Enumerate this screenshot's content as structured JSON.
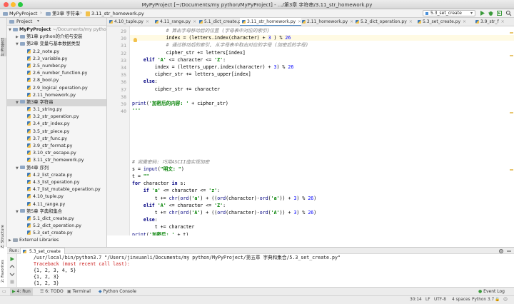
{
  "window": {
    "title": "MyPyProject [~/Documents/my python/MyPyProject] - .../第3章 字符串/3.11_str_homework.py"
  },
  "navbar": {
    "crumbs": [
      "MyPyProject",
      "第3章 字符串",
      "3.11_str_homework.py"
    ],
    "run_config": "5.3_set_create"
  },
  "left_stripe": {
    "project": "1: Project",
    "structure": "Z: Structure",
    "favorites": "2: Favorites"
  },
  "project_panel": {
    "header": "Project",
    "root": {
      "name": "MyPyProject",
      "path": "~/Documents/my pytho"
    },
    "tree": [
      {
        "label": "第1章 python的介绍与安装",
        "type": "folder",
        "depth": 1,
        "open": false
      },
      {
        "label": "第2章 变量与基本数据类型",
        "type": "folder",
        "depth": 1,
        "open": true
      },
      {
        "label": "2.2_note.py",
        "type": "file",
        "depth": 2
      },
      {
        "label": "2.3_variable.py",
        "type": "file",
        "depth": 2
      },
      {
        "label": "2.5_number.py",
        "type": "file",
        "depth": 2
      },
      {
        "label": "2.6_number_function.py",
        "type": "file",
        "depth": 2
      },
      {
        "label": "2.8_bool.py",
        "type": "file",
        "depth": 2
      },
      {
        "label": "2.9_logical_operation.py",
        "type": "file",
        "depth": 2
      },
      {
        "label": "2.11_homework.py",
        "type": "file",
        "depth": 2
      },
      {
        "label": "第3章 字符串",
        "type": "folder",
        "depth": 1,
        "open": true,
        "selected": true
      },
      {
        "label": "3.1_string.py",
        "type": "file",
        "depth": 2
      },
      {
        "label": "3.2_str_operation.py",
        "type": "file",
        "depth": 2
      },
      {
        "label": "3.4_str_index.py",
        "type": "file",
        "depth": 2
      },
      {
        "label": "3.5_str_piece.py",
        "type": "file",
        "depth": 2
      },
      {
        "label": "3.7_str_func.py",
        "type": "file",
        "depth": 2
      },
      {
        "label": "3.9_str_format.py",
        "type": "file",
        "depth": 2
      },
      {
        "label": "3.10_str_escape.py",
        "type": "file",
        "depth": 2
      },
      {
        "label": "3.11_str_homework.py",
        "type": "file",
        "depth": 2
      },
      {
        "label": "第4章 序列",
        "type": "folder",
        "depth": 1,
        "open": true
      },
      {
        "label": "4.2_list_create.py",
        "type": "file",
        "depth": 2
      },
      {
        "label": "4.3_list_operation.py",
        "type": "file",
        "depth": 2
      },
      {
        "label": "4.7_list_mutable_operation.py",
        "type": "file",
        "depth": 2
      },
      {
        "label": "4.10_tuple.py",
        "type": "file",
        "depth": 2
      },
      {
        "label": "4.11_range.py",
        "type": "file",
        "depth": 2
      },
      {
        "label": "第5章 字典和集合",
        "type": "folder",
        "depth": 1,
        "open": true
      },
      {
        "label": "5.1_dict_create.py",
        "type": "file",
        "depth": 2
      },
      {
        "label": "5.2_dict_operation.py",
        "type": "file",
        "depth": 2
      },
      {
        "label": "5.3_set_create.py",
        "type": "file",
        "depth": 2
      },
      {
        "label": "External Libraries",
        "type": "lib",
        "depth": 0,
        "open": false
      }
    ]
  },
  "tabs": [
    {
      "label": "4.10_tuple.py",
      "active": false
    },
    {
      "label": "4.11_range.py",
      "active": false
    },
    {
      "label": "5.1_dict_create.py",
      "active": false
    },
    {
      "label": "3.11_str_homework.py",
      "active": true
    },
    {
      "label": "2.11_homework.py",
      "active": false
    },
    {
      "label": "5.2_dict_operation.py",
      "active": false
    },
    {
      "label": "5.3_set_create.py",
      "active": false
    },
    {
      "label": "3.9_str_f",
      "active": false
    }
  ],
  "editor": {
    "line_numbers": [
      "29",
      "30",
      "31",
      "32",
      "33",
      "34",
      "35",
      "36",
      "37",
      "38",
      "39",
      "40"
    ],
    "code_lines": [
      {
        "ind": 3,
        "tokens": [
          [
            "cmt",
            "# 算出字母移动后的位置 (字母表中对应的索引)"
          ]
        ]
      },
      {
        "ind": 3,
        "hl": true,
        "tokens": [
          [
            "",
            "index = (letters.index(character) + "
          ],
          [
            "num",
            "3"
          ],
          [
            "",
            " ) % "
          ],
          [
            "num",
            "26"
          ]
        ]
      },
      {
        "ind": 3,
        "tokens": [
          [
            "cmt",
            "# 通过移动后的索引, 从字母表中取出对应的字母 (加密后的字母)"
          ]
        ]
      },
      {
        "ind": 3,
        "tokens": [
          [
            "",
            "cipher_str += letters[index]"
          ]
        ]
      },
      {
        "ind": 1,
        "tokens": [
          [
            "kw",
            "elif "
          ],
          [
            "str",
            "'A'"
          ],
          [
            "",
            " <= character <= "
          ],
          [
            "str",
            "'Z'"
          ],
          [
            "",
            ":"
          ]
        ]
      },
      {
        "ind": 2,
        "tokens": [
          [
            "",
            "index = (letters_upper.index(character) + "
          ],
          [
            "num",
            "3"
          ],
          [
            "",
            ") % "
          ],
          [
            "num",
            "26"
          ]
        ]
      },
      {
        "ind": 2,
        "tokens": [
          [
            "",
            "cipher_str += letters_upper[index]"
          ]
        ]
      },
      {
        "ind": 1,
        "tokens": [
          [
            "kw",
            "else"
          ],
          [
            "",
            ":"
          ]
        ]
      },
      {
        "ind": 2,
        "tokens": [
          [
            "",
            "cipher_str += character"
          ]
        ]
      },
      {
        "ind": 0,
        "tokens": []
      },
      {
        "ind": 0,
        "tokens": [
          [
            "bi",
            "print"
          ],
          [
            "",
            "("
          ],
          [
            "str",
            "'加密后的内容: '"
          ],
          [
            "",
            " + cipher_str)"
          ]
        ]
      },
      {
        "ind": 0,
        "tokens": [
          [
            "str",
            "'''"
          ]
        ]
      },
      {
        "ind": 0,
        "tokens": []
      },
      {
        "ind": 0,
        "tokens": []
      },
      {
        "ind": 0,
        "tokens": []
      },
      {
        "ind": 0,
        "tokens": []
      },
      {
        "ind": 0,
        "tokens": []
      },
      {
        "ind": 0,
        "tokens": []
      },
      {
        "ind": 0,
        "tokens": [
          [
            "cmt",
            "# 凯撒密码: 巧用ASCII值实现加密"
          ]
        ]
      },
      {
        "ind": 0,
        "tokens": [
          [
            "",
            "s = "
          ],
          [
            "bi",
            "input"
          ],
          [
            "",
            "("
          ],
          [
            "str",
            "\"明文: \""
          ],
          [
            "",
            ")"
          ]
        ]
      },
      {
        "ind": 0,
        "tokens": [
          [
            "",
            "t = "
          ],
          [
            "str",
            "\"\""
          ]
        ]
      },
      {
        "ind": 0,
        "tokens": [
          [
            "kw",
            "for "
          ],
          [
            "",
            "character "
          ],
          [
            "kw",
            "in "
          ],
          [
            "",
            "s:"
          ]
        ]
      },
      {
        "ind": 1,
        "tokens": [
          [
            "kw",
            "if "
          ],
          [
            "str",
            "'a'"
          ],
          [
            "",
            " <= character <= "
          ],
          [
            "str",
            "'z'"
          ],
          [
            "",
            ":"
          ]
        ]
      },
      {
        "ind": 2,
        "tokens": [
          [
            "",
            "t += "
          ],
          [
            "bi",
            "chr"
          ],
          [
            "",
            "("
          ],
          [
            "bi",
            "ord"
          ],
          [
            "",
            "("
          ],
          [
            "str",
            "'a'"
          ],
          [
            "",
            ") + (("
          ],
          [
            "bi",
            "ord"
          ],
          [
            "",
            "(character)-"
          ],
          [
            "bi",
            "ord"
          ],
          [
            "",
            "("
          ],
          [
            "str",
            "'a'"
          ],
          [
            "",
            ")) + "
          ],
          [
            "num",
            "3"
          ],
          [
            "",
            ") % "
          ],
          [
            "num",
            "26"
          ],
          [
            "",
            ")"
          ]
        ]
      },
      {
        "ind": 1,
        "tokens": [
          [
            "kw",
            "elif "
          ],
          [
            "str",
            "'A'"
          ],
          [
            "",
            " <= character <= "
          ],
          [
            "str",
            "'Z'"
          ],
          [
            "",
            ":"
          ]
        ]
      },
      {
        "ind": 2,
        "tokens": [
          [
            "",
            "t += "
          ],
          [
            "bi",
            "chr"
          ],
          [
            "",
            "("
          ],
          [
            "bi",
            "ord"
          ],
          [
            "",
            "("
          ],
          [
            "str",
            "'A'"
          ],
          [
            "",
            ") + (("
          ],
          [
            "bi",
            "ord"
          ],
          [
            "",
            "(character)-"
          ],
          [
            "bi",
            "ord"
          ],
          [
            "",
            "("
          ],
          [
            "str",
            "'A'"
          ],
          [
            "",
            ")) + "
          ],
          [
            "num",
            "3"
          ],
          [
            "",
            ") % "
          ],
          [
            "num",
            "26"
          ],
          [
            "",
            ")"
          ]
        ]
      },
      {
        "ind": 1,
        "tokens": [
          [
            "kw",
            "else"
          ],
          [
            "",
            ":"
          ]
        ]
      },
      {
        "ind": 2,
        "tokens": [
          [
            "",
            "t += character"
          ]
        ]
      },
      {
        "ind": 0,
        "tokens": [
          [
            "bi",
            "print"
          ],
          [
            "",
            "("
          ],
          [
            "str",
            "'加密后: '"
          ],
          [
            "",
            " + t)"
          ]
        ]
      }
    ]
  },
  "run_panel": {
    "label": "Run:",
    "tab": "5.3_set_create",
    "lines": [
      {
        "kind": "cmd",
        "text": "/usr/local/bin/python3.7 \"/Users/jinxuanli/Documents/my python/MyPyProject/第五章 字典和集合/5.3_set_create.py\""
      },
      {
        "kind": "err",
        "text": "Traceback (most recent call last):"
      },
      {
        "kind": "out",
        "text": "{1, 2, 3, 4, 5}"
      },
      {
        "kind": "out",
        "text": "{1, 2, 3}"
      },
      {
        "kind": "out",
        "text": "{1, 2, 3}"
      }
    ]
  },
  "bottom_toolbar": {
    "run": "4: Run",
    "todo": "6: TODO",
    "terminal": "Terminal",
    "python_console": "Python Console",
    "event_log": "Event Log"
  },
  "status_bar": {
    "position": "30:14",
    "line_sep": "LF",
    "encoding": "UTF-8",
    "indent": "4 spaces",
    "interpreter": "Python 3.7"
  }
}
